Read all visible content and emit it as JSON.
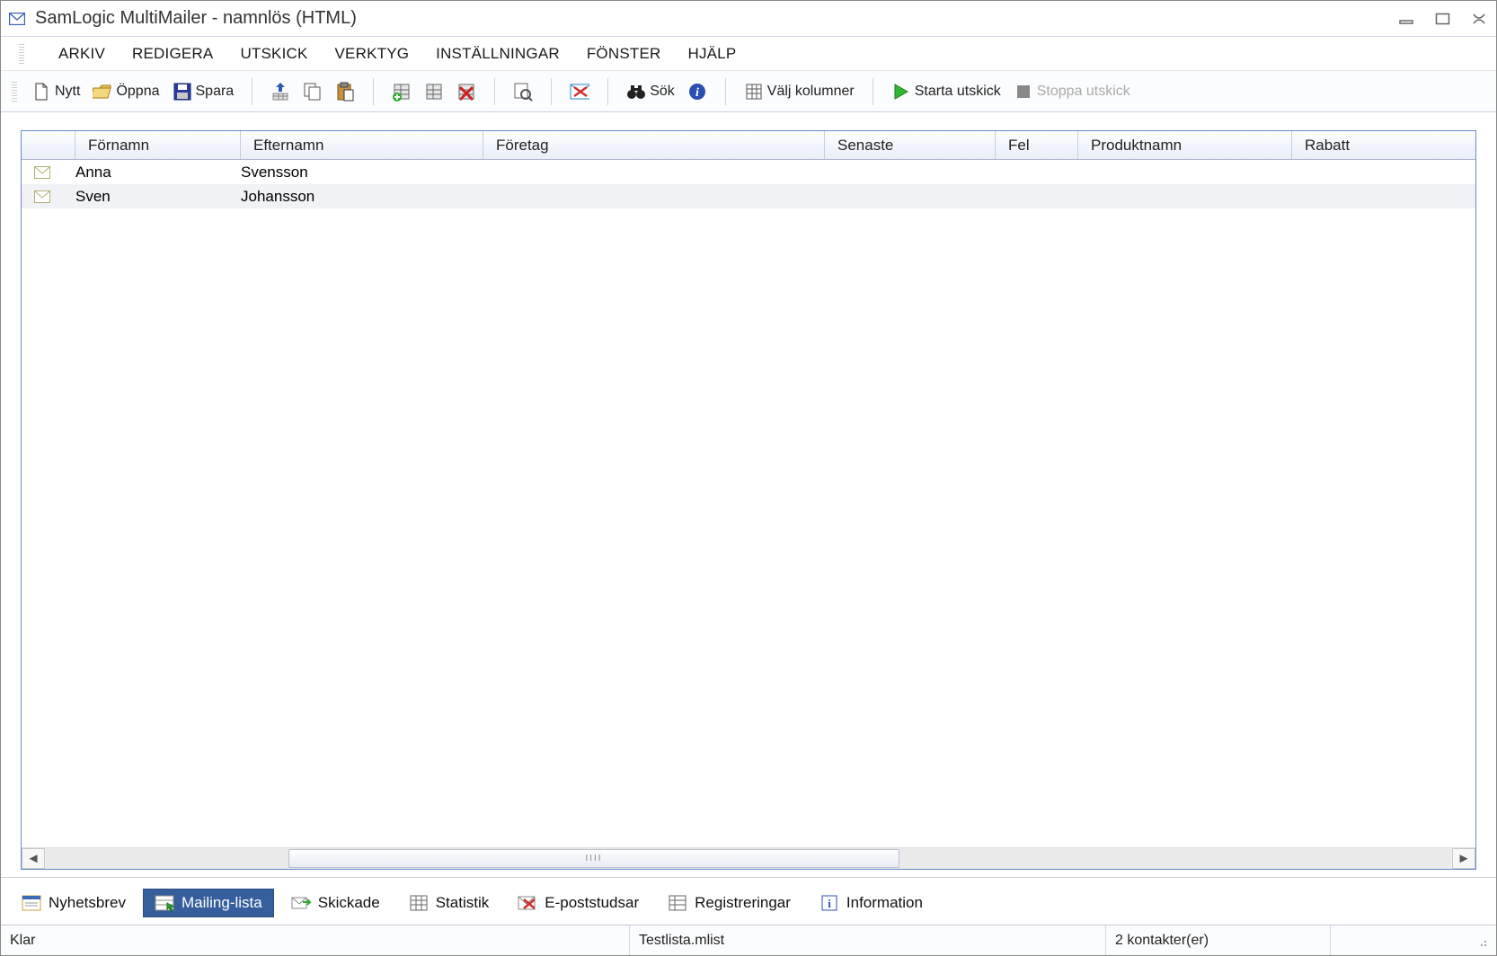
{
  "window": {
    "title": "SamLogic MultiMailer - namnlös  (HTML)"
  },
  "menu": {
    "items": [
      "ARKIV",
      "REDIGERA",
      "UTSKICK",
      "VERKTYG",
      "INSTÄLLNINGAR",
      "FÖNSTER",
      "HJÄLP"
    ]
  },
  "toolbar": {
    "new": "Nytt",
    "open": "Öppna",
    "save": "Spara",
    "search": "Sök",
    "choose_columns": "Välj kolumner",
    "start_send": "Starta utskick",
    "stop_send": "Stoppa utskick"
  },
  "columns": {
    "c0": "",
    "c1": "Förnamn",
    "c2": "Efternamn",
    "c3": "Företag",
    "c4": "Senaste",
    "c5": "Fel",
    "c6": "Produktnamn",
    "c7": "Rabatt"
  },
  "rows": [
    {
      "fornamn": "Anna",
      "efternamn": "Svensson",
      "foretag": "",
      "senaste": "",
      "fel": "",
      "produkt": "",
      "rabatt": ""
    },
    {
      "fornamn": "Sven",
      "efternamn": "Johansson",
      "foretag": "",
      "senaste": "",
      "fel": "",
      "produkt": "",
      "rabatt": ""
    }
  ],
  "tabs": {
    "t0": "Nyhetsbrev",
    "t1": "Mailing-lista",
    "t2": "Skickade",
    "t3": "Statistik",
    "t4": "E-poststudsar",
    "t5": "Registreringar",
    "t6": "Information"
  },
  "status": {
    "ready": "Klar",
    "file": "Testlista.mlist",
    "count": "2 kontakter(er)"
  }
}
